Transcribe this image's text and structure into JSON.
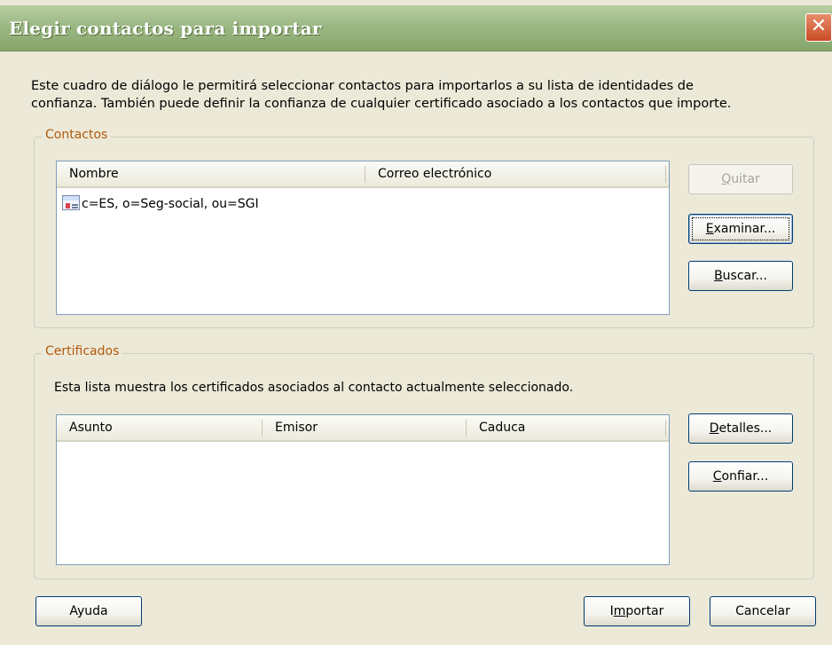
{
  "window": {
    "title": "Elegir contactos para importar",
    "close_glyph": "✕"
  },
  "intro": {
    "line1": "Este cuadro de diálogo le permitirá seleccionar contactos para importarlos a su lista de identidades de",
    "line2": "confianza. También puede definir la confianza de cualquier certificado asociado a los contactos que importe."
  },
  "contacts": {
    "legend": "Contactos",
    "columns": [
      "Nombre",
      "Correo electrónico"
    ],
    "rows": [
      {
        "name": "c=ES, o=Seg-social, ou=SGI",
        "email": "",
        "icon": "contact-card-icon"
      }
    ],
    "buttons": {
      "remove": {
        "mnemonic": "Q",
        "rest": "uitar"
      },
      "browse": {
        "mnemonic": "E",
        "rest": "xaminar..."
      },
      "search": {
        "mnemonic": "B",
        "rest": "uscar..."
      }
    }
  },
  "certificates": {
    "legend": "Certificados",
    "description": "Esta lista muestra los certificados asociados al contacto actualmente seleccionado.",
    "columns": [
      "Asunto",
      "Emisor",
      "Caduca"
    ],
    "buttons": {
      "details": {
        "mnemonic": "D",
        "rest": "etalles..."
      },
      "trust": {
        "mnemonic": "C",
        "rest": "onfiar..."
      }
    }
  },
  "footer": {
    "help_label": "Ayuda",
    "import": {
      "pre": "I",
      "mnemonic": "m",
      "rest": "portar"
    },
    "cancel_label": "Cancelar"
  },
  "colors": {
    "titlebar": "#9bb883",
    "legend_text": "#b35a0b",
    "dialog_bg": "#ECE9D8"
  }
}
